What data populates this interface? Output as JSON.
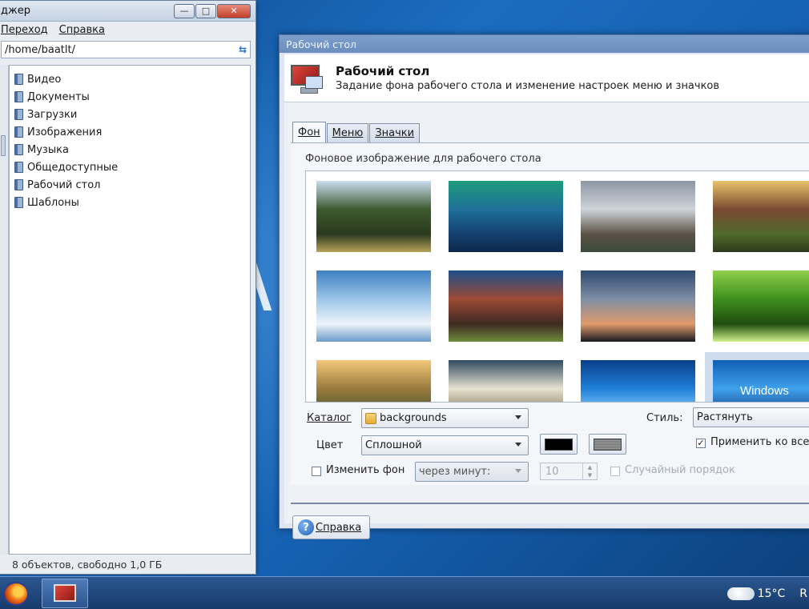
{
  "file_manager": {
    "title": "джер",
    "menu": [
      "Переход",
      "Справка"
    ],
    "path": "/home/baatlt/",
    "items": [
      {
        "label": "Видео"
      },
      {
        "label": "Документы"
      },
      {
        "label": "Загрузки"
      },
      {
        "label": "Изображения"
      },
      {
        "label": "Музыка"
      },
      {
        "label": "Общедоступные"
      },
      {
        "label": "Рабочий стол"
      },
      {
        "label": "Шаблоны"
      }
    ],
    "status": "8 объектов, свободно 1,0 ГБ"
  },
  "dialog": {
    "window_title": "Рабочий стол",
    "header_title": "Рабочий стол",
    "header_subtitle": "Задание фона рабочего стола и изменение настроек меню и значков",
    "tabs": [
      "Фон",
      "Меню",
      "Значки"
    ],
    "active_tab": "Фон",
    "gallery_label": "Фоновое изображение для рабочего стола",
    "wallpapers": [
      {
        "name": "temple-lake",
        "colors": [
          "#c9ddf0",
          "#3c5a2e",
          "#2b3a1f",
          "#b8a25a"
        ]
      },
      {
        "name": "green-wave",
        "colors": [
          "#1e9c7b",
          "#1f6f9a",
          "#14406e",
          "#0d2a4d"
        ]
      },
      {
        "name": "matterhorn",
        "colors": [
          "#8d96a3",
          "#cfd4da",
          "#5b5246",
          "#3a4a3a"
        ]
      },
      {
        "name": "tree-bark",
        "colors": [
          "#e8c36a",
          "#7a4a32",
          "#4f6a2c",
          "#2f3a1c"
        ]
      },
      {
        "name": "clouds",
        "colors": [
          "#3f7fc2",
          "#9cc5e8",
          "#eef4fa",
          "#6c9bc9"
        ]
      },
      {
        "name": "red-rock",
        "colors": [
          "#1c4f8a",
          "#9d4a35",
          "#3e2a22",
          "#6d8a3a"
        ]
      },
      {
        "name": "lone-tree",
        "colors": [
          "#2e4a70",
          "#7e8ea5",
          "#e09a6a",
          "#1a1a22"
        ]
      },
      {
        "name": "green-leaf",
        "colors": [
          "#8ed04b",
          "#3f8f1e",
          "#1f4d10",
          "#d0f08a"
        ]
      },
      {
        "name": "sunset-field",
        "colors": [
          "#f4c779",
          "#9a7a3f",
          "#4a5a2e",
          "#2a3318"
        ]
      },
      {
        "name": "blossom",
        "colors": [
          "#2f4a5e",
          "#e8e2d2",
          "#8a7a5a",
          "#1a2a34"
        ]
      },
      {
        "name": "blue-light",
        "colors": [
          "#0b3f8a",
          "#1e7fd8",
          "#8fd0ff",
          "#072a5e"
        ]
      },
      {
        "name": "windows-7",
        "colors": [
          "#0f5fb5",
          "#3fa1ec",
          "#1a4a8e",
          "#ffffff"
        ]
      }
    ],
    "selected_wallpaper": 11,
    "windows_logo_text": "Windows",
    "catalog_label": "Каталог",
    "catalog_value": "backgrounds",
    "style_label": "Стиль:",
    "style_value": "Растянуть",
    "color_label": "Цвет",
    "color_mode": "Сплошной",
    "primary_color": "#000000",
    "secondary_color": "#8a8a8a",
    "apply_all_label": "Применить ко все",
    "apply_all_checked": true,
    "change_bg_label": "Изменить фон",
    "change_bg_checked": false,
    "interval_value": "через минут:",
    "interval_number": "10",
    "random_label": "Случайный порядок",
    "random_checked": false,
    "help_label": "Справка"
  },
  "taskbar": {
    "temperature": "15°C",
    "keyboard": "R"
  }
}
